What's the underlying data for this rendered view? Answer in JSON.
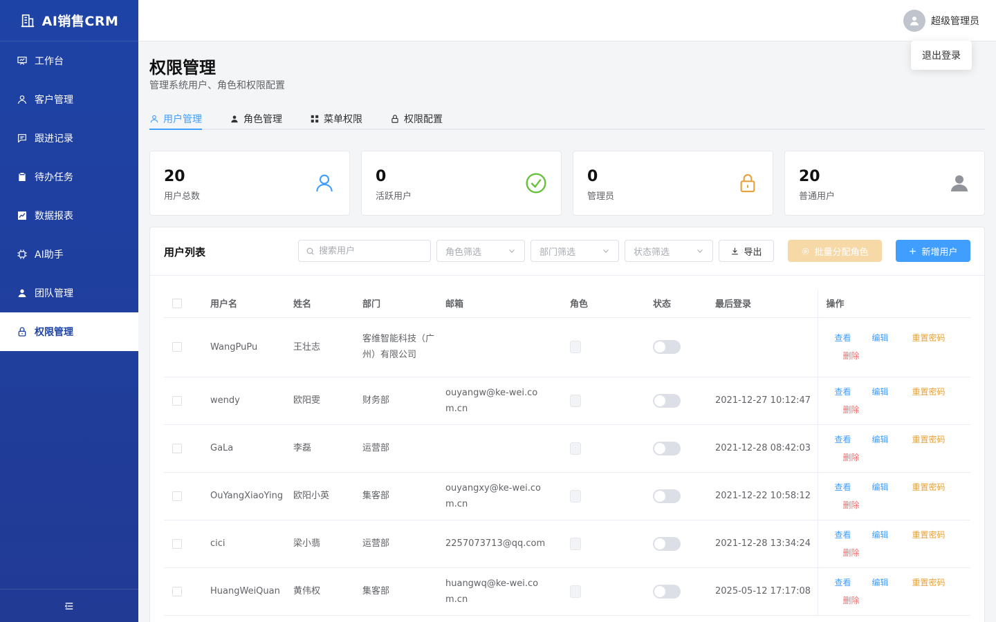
{
  "brand": {
    "title": "AI销售CRM",
    "icon": "building-icon"
  },
  "sidebar": {
    "items": [
      {
        "label": "工作台",
        "icon": "dashboard-icon",
        "active": false
      },
      {
        "label": "客户管理",
        "icon": "user-icon",
        "active": false
      },
      {
        "label": "跟进记录",
        "icon": "message-icon",
        "active": false
      },
      {
        "label": "待办任务",
        "icon": "clipboard-icon",
        "active": false
      },
      {
        "label": "数据报表",
        "icon": "chart-icon",
        "active": false
      },
      {
        "label": "AI助手",
        "icon": "chip-icon",
        "active": false
      },
      {
        "label": "团队管理",
        "icon": "team-icon",
        "active": false
      },
      {
        "label": "权限管理",
        "icon": "lock-icon",
        "active": true
      }
    ],
    "collapse_icon": "menu-collapse-icon"
  },
  "header": {
    "username": "超级管理员",
    "logout_label": "退出登录"
  },
  "page": {
    "title": "权限管理",
    "subtitle": "管理系统用户、角色和权限配置"
  },
  "tabs": [
    {
      "label": "用户管理",
      "active": true
    },
    {
      "label": "角色管理",
      "active": false
    },
    {
      "label": "菜单权限",
      "active": false
    },
    {
      "label": "权限配置",
      "active": false
    }
  ],
  "stats": [
    {
      "value": "20",
      "label": "用户总数",
      "icon": "user-outline-icon",
      "color": "#409eff"
    },
    {
      "value": "0",
      "label": "活跃用户",
      "icon": "check-circle-icon",
      "color": "#67c23a"
    },
    {
      "value": "0",
      "label": "管理员",
      "icon": "lock-icon",
      "color": "#e6a23c"
    },
    {
      "value": "20",
      "label": "普通用户",
      "icon": "user-solid-icon",
      "color": "#909399"
    }
  ],
  "list": {
    "title": "用户列表",
    "search_placeholder": "搜索用户",
    "role_filter": "角色筛选",
    "dept_filter": "部门筛选",
    "status_filter": "状态筛选",
    "export_label": "导出",
    "batch_label": "批量分配角色",
    "add_label": "新增用户"
  },
  "table": {
    "columns": [
      "用户名",
      "姓名",
      "部门",
      "邮箱",
      "角色",
      "状态",
      "最后登录",
      "操作"
    ],
    "ops": {
      "view": "查看",
      "edit": "编辑",
      "reset": "重置密码",
      "delete": "删除"
    },
    "rows": [
      {
        "username": "WangPuPu",
        "name": "王壮志",
        "dept": "客维智能科技（广州）有限公司",
        "email": "",
        "last_login": ""
      },
      {
        "username": "wendy",
        "name": "欧阳雯",
        "dept": "财务部",
        "email": "ouyangw@ke-wei.com.cn",
        "last_login": "2021-12-27 10:12:47"
      },
      {
        "username": "GaLa",
        "name": "李磊",
        "dept": "运营部",
        "email": "",
        "last_login": "2021-12-28 08:42:03"
      },
      {
        "username": "OuYangXiaoYing",
        "name": "欧阳小英",
        "dept": "集客部",
        "email": "ouyangxy@ke-wei.com.cn",
        "last_login": "2021-12-22 10:58:12"
      },
      {
        "username": "cici",
        "name": "梁小翡",
        "dept": "运营部",
        "email": "2257073713@qq.com",
        "last_login": "2021-12-28 13:34:24"
      },
      {
        "username": "HuangWeiQuan",
        "name": "黄伟权",
        "dept": "集客部",
        "email": "huangwq@ke-wei.com.cn",
        "last_login": "2025-05-12 17:17:08"
      }
    ]
  }
}
